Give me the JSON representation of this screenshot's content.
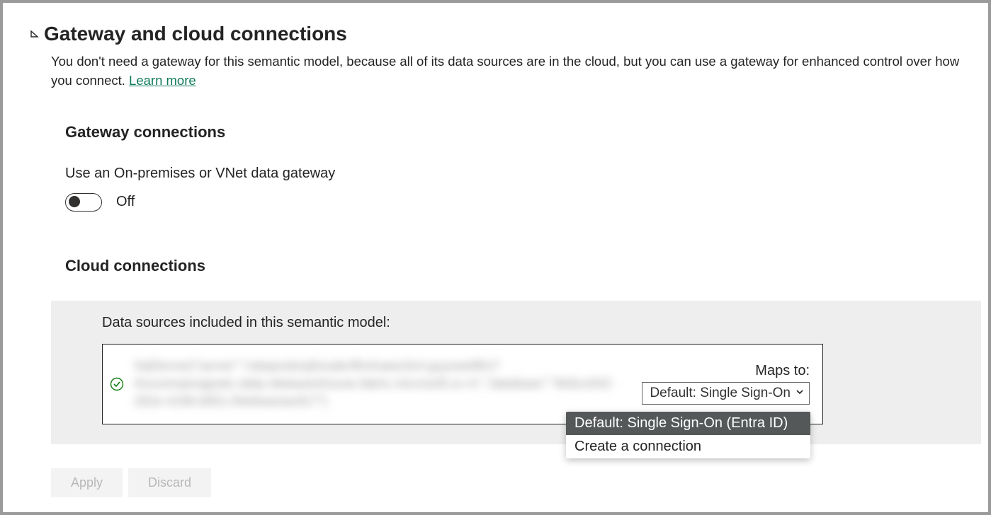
{
  "header": {
    "title": "Gateway and cloud connections",
    "description_pre": "You don't need a gateway for this semantic model, because all of its data sources are in the cloud, but you can use a gateway for enhanced control over how you connect. ",
    "learn_more": "Learn more"
  },
  "gateway": {
    "section_title": "Gateway connections",
    "toggle_label": "Use an On-premises or VNet data gateway",
    "toggle_state": "Off"
  },
  "cloud": {
    "section_title": "Cloud connections",
    "panel_caption": "Data sources included in this semantic model:",
    "maps_label": "Maps to:",
    "maps_selected": "Default: Single Sign-On",
    "dropdown": {
      "option_selected": "Default: Single Sign-On (Entra ID)",
      "option_create": "Create a connection"
    }
  },
  "buttons": {
    "apply": "Apply",
    "discard": "Discard"
  }
}
